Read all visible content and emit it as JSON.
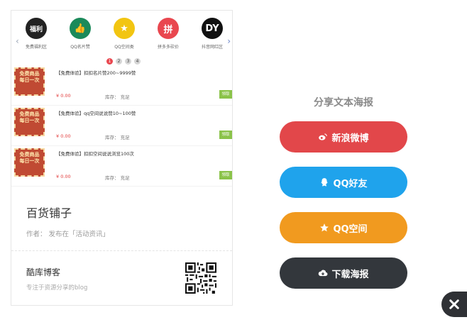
{
  "poster": {
    "categories": [
      {
        "label": "免费福利区",
        "glyph": "福利",
        "color": "#222222"
      },
      {
        "label": "QQ名片赞",
        "glyph": "👍",
        "color": "#1b8a5a"
      },
      {
        "label": "QQ空间类",
        "glyph": "★",
        "color": "#f2c511"
      },
      {
        "label": "拼多多砍价",
        "glyph": "拼",
        "color": "#e9474f"
      },
      {
        "label": "抖音网红区",
        "glyph": "DY",
        "color": "#111111"
      }
    ],
    "page_dots": [
      "1",
      "2",
      "3",
      "4"
    ],
    "products": [
      {
        "title": "【免费体验】扣扣名片赞200~9999赞",
        "price": "¥ 0.00",
        "stock": "库存：  充足",
        "button": "领取",
        "thumb": "免费商品 每日一次"
      },
      {
        "title": "【免费体验】qq空间说说赞10~100赞",
        "price": "¥ 0.00",
        "stock": "库存：  充足",
        "button": "领取",
        "thumb": "免费商品 每日一次"
      },
      {
        "title": "【免费体验】扣扣空间说说浏览100次",
        "price": "¥ 0.00",
        "stock": "库存：  充足",
        "button": "领取",
        "thumb": "免费商品 每日一次"
      }
    ],
    "shop_name": "百货铺子",
    "author_line": "作者：    发布在「活动资讯」",
    "blog_name": "酷库博客",
    "blog_sub": "专注于资源分享的blog"
  },
  "share": {
    "title": "分享文本海报",
    "buttons": [
      {
        "label": "新浪微博",
        "icon": "weibo-icon",
        "color": "#e2474a"
      },
      {
        "label": "QQ好友",
        "icon": "qq-icon",
        "color": "#1fa3ec"
      },
      {
        "label": "QQ空间",
        "icon": "star-icon",
        "color": "#f19a1f"
      },
      {
        "label": "下载海报",
        "icon": "cloud-download-icon",
        "color": "#33373c"
      }
    ]
  },
  "close_icon": "close-icon"
}
